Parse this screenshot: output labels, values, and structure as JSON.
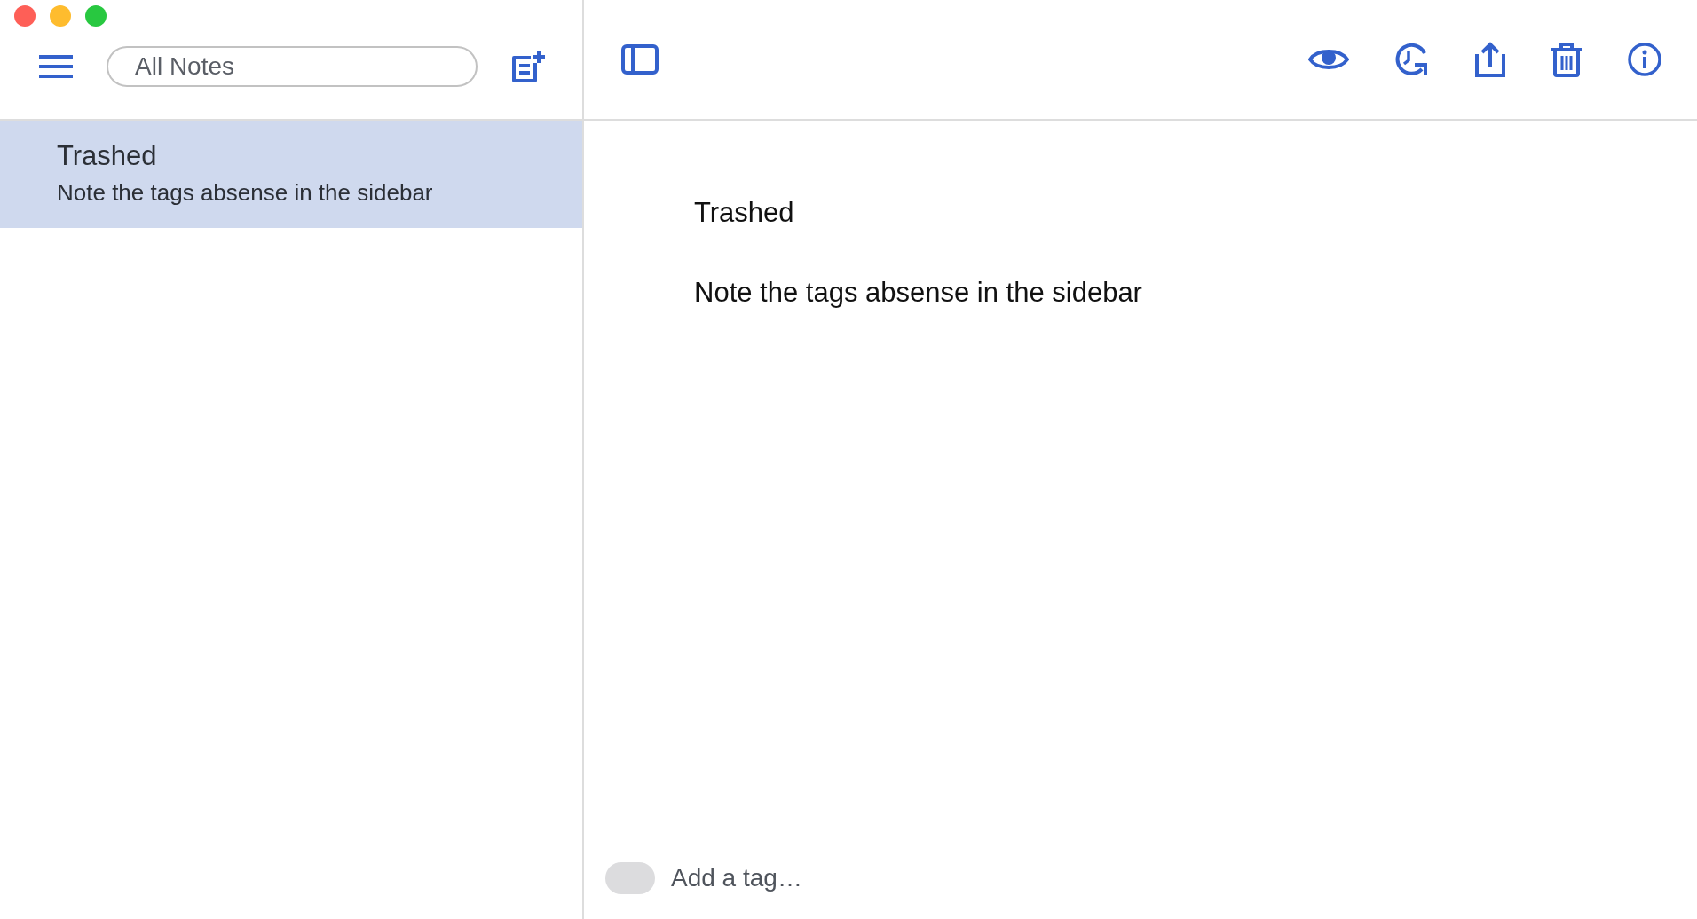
{
  "window": {
    "controls": [
      {
        "color": "#fe5f57"
      },
      {
        "color": "#febc2e"
      },
      {
        "color": "#28c840"
      }
    ]
  },
  "sidebar": {
    "search": {
      "value": "All Notes"
    },
    "notes": [
      {
        "title": "Trashed",
        "preview": "Note the tags absense in the sidebar",
        "selected": true
      }
    ]
  },
  "editor": {
    "title": "Trashed",
    "body": "Note the tags absense in the sidebar",
    "tag_field": {
      "placeholder": "Add a tag…"
    }
  }
}
